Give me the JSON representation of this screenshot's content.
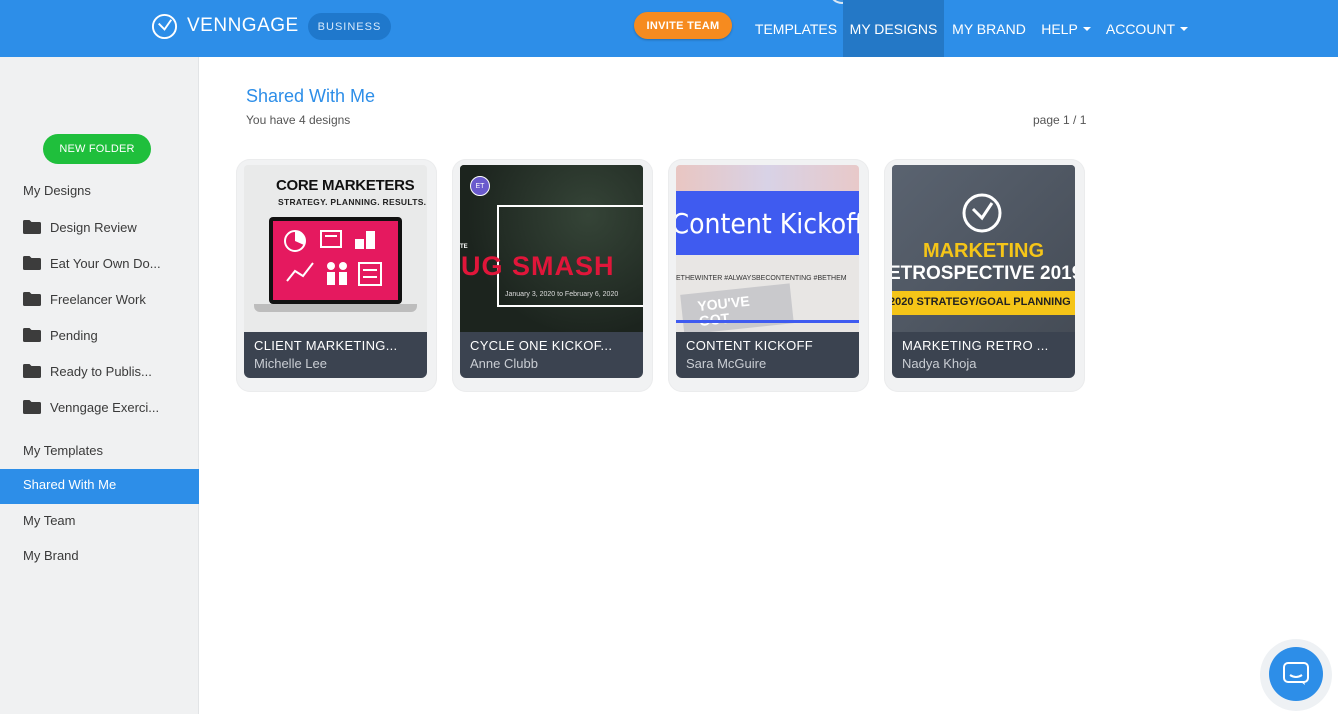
{
  "header": {
    "brand": "VENNGAGE",
    "plan_badge": "BUSINESS",
    "invite_button": "INVITE TEAM",
    "nav": [
      {
        "label": "TEMPLATES",
        "active": false,
        "dropdown": false
      },
      {
        "label": "MY DESIGNS",
        "active": true,
        "dropdown": false
      },
      {
        "label": "MY BRAND",
        "active": false,
        "dropdown": false
      },
      {
        "label": "HELP",
        "active": false,
        "dropdown": true
      },
      {
        "label": "ACCOUNT",
        "active": false,
        "dropdown": true
      }
    ]
  },
  "sidebar": {
    "new_folder_button": "NEW FOLDER",
    "my_designs": "My Designs",
    "folders": [
      "Design Review",
      "Eat Your Own Do...",
      "Freelancer Work",
      "Pending",
      "Ready to Publis...",
      "Venngage Exerci..."
    ],
    "links": [
      {
        "label": "My Templates",
        "active": false
      },
      {
        "label": "Shared With Me",
        "active": true
      },
      {
        "label": "My Team",
        "active": false
      },
      {
        "label": "My Brand",
        "active": false
      }
    ]
  },
  "main": {
    "title": "Shared With Me",
    "subtitle": "You have 4 designs",
    "pagination": "page 1 / 1",
    "designs": [
      {
        "title": "CLIENT MARKETING...",
        "author": "Michelle Lee",
        "thumb": {
          "heading": "CORE MARKETERS",
          "tagline": "STRATEGY. PLANNING. RESULTS."
        }
      },
      {
        "title": "CYCLE ONE KICKOF...",
        "author": "Anne Clubb",
        "thumb": {
          "avatar": "ET",
          "prefix": "TE",
          "headline": "UG SMASH",
          "dates": "January 3, 2020 to February 6, 2020"
        }
      },
      {
        "title": "CONTENT KICKOFF",
        "author": "Sara McGuire",
        "thumb": {
          "headline": "Content Kickoff",
          "hashtags": "ETHEWINTER #ALWAYSBECONTENTING #BETHEM",
          "sticker": "YOU'VE GOT"
        }
      },
      {
        "title": "MARKETING RETRO ...",
        "author": "Nadya Khoja",
        "thumb": {
          "line1": "MARKETING",
          "line2": "ETROSPECTIVE 2019",
          "banner": "2020 STRATEGY/GOAL PLANNING"
        }
      }
    ]
  },
  "colors": {
    "brand_blue": "#2d8ee8",
    "invite_orange": "#f68b1f",
    "new_folder_green": "#1fbf3c",
    "caption_dark": "#3b4350",
    "thumb_pink": "#e5195f",
    "thumb_red": "#e0163a",
    "thumb_royal_blue": "#3f5bf0",
    "thumb_yellow": "#f5c518"
  },
  "icons": {
    "logo": "venngage-clock-logo-icon",
    "folder": "folder-icon",
    "caret": "caret-down-icon",
    "chat": "chat-bubble-icon"
  }
}
